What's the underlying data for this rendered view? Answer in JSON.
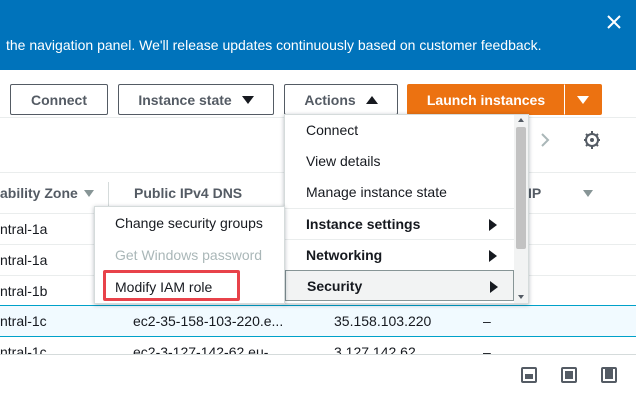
{
  "banner": {
    "text": "the navigation panel. We'll release updates continuously based on customer feedback.",
    "close_icon": "close-icon",
    "color": "#0073bb"
  },
  "toolbar": {
    "connect_label": "Connect",
    "instance_state_label": "Instance state",
    "actions_label": "Actions",
    "launch_label": "Launch instances",
    "launch_color": "#ec7211"
  },
  "table": {
    "columns": [
      "ability Zone",
      "Public IPv4 DNS",
      "IP"
    ],
    "rows": [
      {
        "az": "ntral-1a",
        "dns": "",
        "ip": "",
        "dash": ""
      },
      {
        "az": "ntral-1a",
        "dns": "",
        "ip": "",
        "dash": ""
      },
      {
        "az": "ntral-1b",
        "dns": "",
        "ip": "",
        "dash": ""
      },
      {
        "az": "ntral-1c",
        "dns": "ec2-35-158-103-220.e...",
        "ip": "35.158.103.220",
        "dash": "–"
      },
      {
        "az": "ntral-1c",
        "dns": "ec2-3-127-142-62.eu-...",
        "ip": "3.127.142.62",
        "dash": "–"
      }
    ]
  },
  "actions_menu": {
    "items": [
      {
        "label": "Connect"
      },
      {
        "label": "View details"
      },
      {
        "label": "Manage instance state"
      },
      {
        "label": "Instance settings"
      },
      {
        "label": "Networking"
      },
      {
        "label": "Security"
      }
    ]
  },
  "security_submenu": {
    "items": [
      {
        "label": "Change security groups"
      },
      {
        "label": "Get Windows password"
      },
      {
        "label": "Modify IAM role"
      }
    ],
    "highlight_color": "#e8424a"
  }
}
